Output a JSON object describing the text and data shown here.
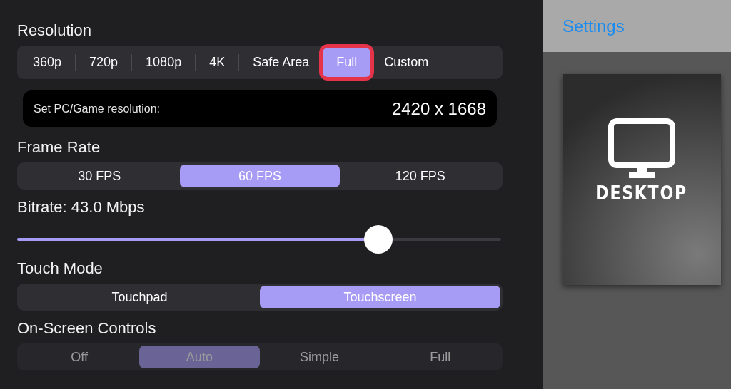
{
  "settings": {
    "sections": [
      {
        "kind": "segments",
        "title": "Resolution",
        "dividers": true,
        "disabled": false,
        "options": [
          {
            "label": "360p",
            "selected": false,
            "highlighted": false
          },
          {
            "label": "720p",
            "selected": false,
            "highlighted": false
          },
          {
            "label": "1080p",
            "selected": false,
            "highlighted": false
          },
          {
            "label": "4K",
            "selected": false,
            "highlighted": false
          },
          {
            "label": "Safe Area",
            "selected": false,
            "highlighted": false
          },
          {
            "label": "Full",
            "selected": true,
            "highlighted": true
          },
          {
            "label": "Custom",
            "selected": false,
            "highlighted": false
          }
        ],
        "field": {
          "label": "Set PC/Game resolution:",
          "value": "2420 x 1668"
        }
      },
      {
        "kind": "segments",
        "title": "Frame Rate",
        "dividers": false,
        "disabled": false,
        "options": [
          {
            "label": "30 FPS",
            "selected": false,
            "highlighted": false
          },
          {
            "label": "60 FPS",
            "selected": true,
            "highlighted": false
          },
          {
            "label": "120 FPS",
            "selected": false,
            "highlighted": false
          }
        ]
      },
      {
        "kind": "slider",
        "title": "Bitrate: 43.0 Mbps",
        "level": 0.746
      },
      {
        "kind": "segments",
        "title": "Touch Mode",
        "dividers": false,
        "disabled": false,
        "options": [
          {
            "label": "Touchpad",
            "selected": false,
            "highlighted": false
          },
          {
            "label": "Touchscreen",
            "selected": true,
            "highlighted": false
          }
        ]
      },
      {
        "kind": "segments",
        "title": "On-Screen Controls",
        "dividers": true,
        "disabled": true,
        "options": [
          {
            "label": "Off",
            "selected": false,
            "highlighted": false
          },
          {
            "label": "Auto",
            "selected": true,
            "highlighted": false
          },
          {
            "label": "Simple",
            "selected": false,
            "highlighted": false
          },
          {
            "label": "Full",
            "selected": false,
            "highlighted": false
          }
        ]
      }
    ]
  },
  "sidebar": {
    "title": "Settings",
    "card": {
      "label": "DESKTOP"
    }
  }
}
